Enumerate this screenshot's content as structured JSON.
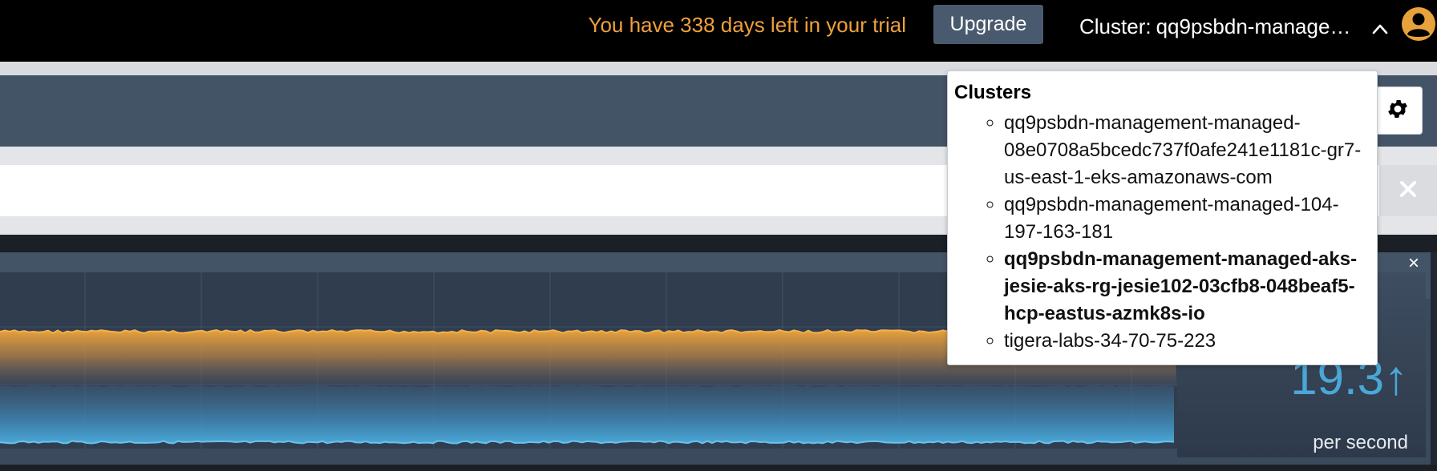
{
  "topbar": {
    "trial_message": "You have 338 days left in your trial",
    "upgrade_label": "Upgrade",
    "cluster_prefix": "Cluster:",
    "cluster_current": "qq9psbdn-managem..."
  },
  "clusters_dropdown": {
    "title": "Clusters",
    "items": [
      "qq9psbdn-management-managed-08e0708a5bcedc737f0afe241e1181c-gr7-us-east-1-eks-amazonaws-com",
      "qq9psbdn-management-managed-104-197-163-181",
      "qq9psbdn-management-managed-aks-jesie-aks-rg-jesie102-03cfb8-048beaf5-hcp-eastus-azmk8s-io",
      "tigera-labs-34-70-75-223"
    ],
    "selected_index": 2
  },
  "panel": {
    "close_glyph": "×"
  },
  "stat": {
    "value": "19.3↑",
    "unit": "per second"
  },
  "icons": {
    "chevron": "chevron-up-icon",
    "avatar": "user-avatar-icon",
    "settings": "gear-icon",
    "clear": "close-icon"
  },
  "colors": {
    "trial_text": "#f0a03c",
    "upgrade_bg": "#4a5a6e",
    "orange_series": "#e9a23b",
    "blue_series": "#4aa8d8",
    "panel_bg": "#3b4a5c"
  }
}
